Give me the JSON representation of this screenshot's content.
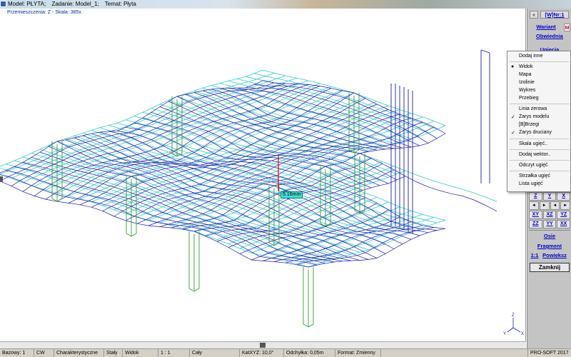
{
  "window": {
    "title_parts": [
      "Model: PŁYTA;",
      "Zadanie: Model_1;",
      "Temat: Płyta"
    ]
  },
  "viewport": {
    "status_label": "Przemieszczenia: Z - Skala: 385x",
    "value_label": "5.16mm",
    "axis_labels": {
      "z": "Z",
      "y": "Y",
      "x": "X"
    }
  },
  "panel": {
    "nav_arrow": "«",
    "wjnr": "[W]Nr:1",
    "wariant": "Wariant",
    "m_badge": "M",
    "obwiednia": "Obwiednia",
    "ugiecia": "Ugięcia",
    "axis_rows": [
      [
        "Z",
        "Y",
        "X"
      ],
      [
        "◄",
        "►",
        "◄",
        "►"
      ],
      [
        "XY",
        "XZ",
        "YZ"
      ],
      [
        "ZZ",
        "YY",
        "XX"
      ]
    ],
    "osie": "Osie",
    "fragment": "Fragment",
    "scale_1_1": "1:1",
    "powieksz": "Powiększ",
    "zamknij": "Zamknij"
  },
  "context_menu": {
    "items": [
      {
        "label": "Dodaj inne",
        "mark": ""
      },
      {
        "label": "Widok",
        "mark": "●"
      },
      {
        "label": "Mapa",
        "mark": ""
      },
      {
        "label": "Izolinie",
        "mark": ""
      },
      {
        "label": "Wykres",
        "mark": ""
      },
      {
        "label": "Przebieg",
        "mark": ""
      },
      {
        "label": "Linia zerowa",
        "mark": ""
      },
      {
        "label": "Zarys modelu",
        "mark": "✓"
      },
      {
        "label": "[B]Brzegi",
        "mark": ""
      },
      {
        "label": "Zarys druciany",
        "mark": "✓"
      },
      {
        "label": "Skala ugięć..",
        "mark": ""
      },
      {
        "label": "Dodaj wektor..",
        "mark": ""
      },
      {
        "label": "Odczyt ugięć",
        "mark": ""
      },
      {
        "label": "Strzałka ugięć",
        "mark": ""
      },
      {
        "label": "Lista ugięć",
        "mark": ""
      }
    ]
  },
  "statusbar": {
    "fields": [
      "Bazowy: 1",
      "CW",
      "Charakterystyczne",
      "Stały",
      "Widok",
      "1 : 1",
      "Cały",
      "KatXYZ: 10,0°",
      "Odchyłka: 0,05m",
      "Format: Zmienny",
      "",
      "PRO-SOFT 2017"
    ]
  },
  "colors": {
    "mesh_deformed": "#1a1ab8",
    "mesh_original": "#33cccc",
    "columns": "#2ea02e",
    "vector": "#e02020"
  }
}
